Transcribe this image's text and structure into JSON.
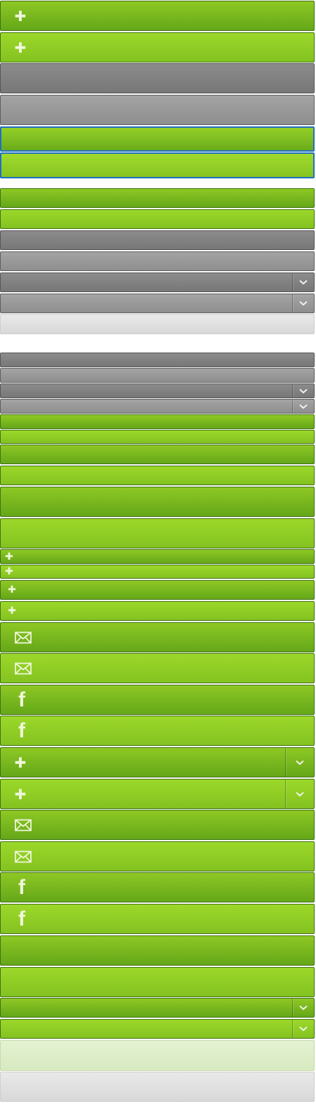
{
  "buttons": [
    {
      "id": "btn-add-1",
      "skin": "g-a",
      "icon": "plus-icon"
    },
    {
      "id": "btn-add-2",
      "skin": "g-b",
      "icon": "plus-icon"
    },
    {
      "id": "btn-gray-1",
      "skin": "gr-a"
    },
    {
      "id": "btn-gray-2",
      "skin": "gr-b"
    },
    {
      "id": "btn-focused-1",
      "skin": "g-focus"
    },
    {
      "id": "btn-focused-2",
      "skin": "g-focus2"
    },
    {
      "id": "btn-green-1",
      "skin": "g-a"
    },
    {
      "id": "btn-green-2",
      "skin": "g-b"
    },
    {
      "id": "btn-gray-3",
      "skin": "gr-a"
    },
    {
      "id": "btn-gray-4",
      "skin": "gr-b"
    },
    {
      "id": "btn-gray-dropdown-1",
      "skin": "gr-a",
      "dropdown": true
    },
    {
      "id": "btn-gray-dropdown-2",
      "skin": "gr-b",
      "dropdown": true
    },
    {
      "id": "btn-disabled-1",
      "skin": "lightgray"
    },
    {
      "id": "btn-gray-mini-1",
      "skin": "gr-a"
    },
    {
      "id": "btn-gray-mini-2",
      "skin": "gr-b"
    },
    {
      "id": "btn-gray-mini-dropdown-1",
      "skin": "gr-a",
      "dropdown": true
    },
    {
      "id": "btn-gray-mini-dropdown-2",
      "skin": "gr-b",
      "dropdown": true
    },
    {
      "id": "btn-green-mini-1",
      "skin": "g-a"
    },
    {
      "id": "btn-green-mini-2",
      "skin": "g-b"
    },
    {
      "id": "btn-green-3",
      "skin": "g-a"
    },
    {
      "id": "btn-green-4",
      "skin": "g-b"
    },
    {
      "id": "btn-green-large-1",
      "skin": "g-a"
    },
    {
      "id": "btn-green-large-2",
      "skin": "g-b"
    },
    {
      "id": "btn-add-mini-1",
      "skin": "g-a",
      "icon": "plus-icon",
      "small": true
    },
    {
      "id": "btn-add-mini-2",
      "skin": "g-b",
      "icon": "plus-icon",
      "small": true
    },
    {
      "id": "btn-add-3",
      "skin": "g-a",
      "icon": "plus-icon",
      "small": true
    },
    {
      "id": "btn-add-4",
      "skin": "g-b",
      "icon": "plus-icon",
      "small": true
    },
    {
      "id": "btn-mail-1",
      "skin": "g-a",
      "icon": "mail-icon"
    },
    {
      "id": "btn-mail-2",
      "skin": "g-b",
      "icon": "mail-icon"
    },
    {
      "id": "btn-facebook-1",
      "skin": "g-a",
      "icon": "facebook-icon"
    },
    {
      "id": "btn-facebook-2",
      "skin": "g-b",
      "icon": "facebook-icon"
    },
    {
      "id": "btn-add-dropdown-1",
      "skin": "g-a",
      "icon": "plus-icon",
      "dropdown": true
    },
    {
      "id": "btn-add-dropdown-2",
      "skin": "g-b",
      "icon": "plus-icon",
      "dropdown": true
    },
    {
      "id": "btn-mail-3",
      "skin": "g-a",
      "icon": "mail-icon"
    },
    {
      "id": "btn-mail-4",
      "skin": "g-b",
      "icon": "mail-icon"
    },
    {
      "id": "btn-facebook-3",
      "skin": "g-a",
      "icon": "facebook-icon"
    },
    {
      "id": "btn-facebook-4",
      "skin": "g-b",
      "icon": "facebook-icon"
    },
    {
      "id": "btn-green-large-3",
      "skin": "g-a"
    },
    {
      "id": "btn-green-large-4",
      "skin": "g-b"
    },
    {
      "id": "btn-green-dropdown-1",
      "skin": "g-a",
      "dropdown": true
    },
    {
      "id": "btn-green-dropdown-2",
      "skin": "g-b",
      "dropdown": true
    },
    {
      "id": "btn-disabled-green",
      "skin": "palegreen"
    },
    {
      "id": "btn-disabled-gray",
      "skin": "lightgray"
    }
  ],
  "colors": {
    "green_dark": "#65a719",
    "green_light": "#9cd82a",
    "gray_dark": "#777777",
    "gray_light": "#a4a4a4",
    "focus_border": "#1f6fc2",
    "icon_fill": "#eef7da"
  }
}
